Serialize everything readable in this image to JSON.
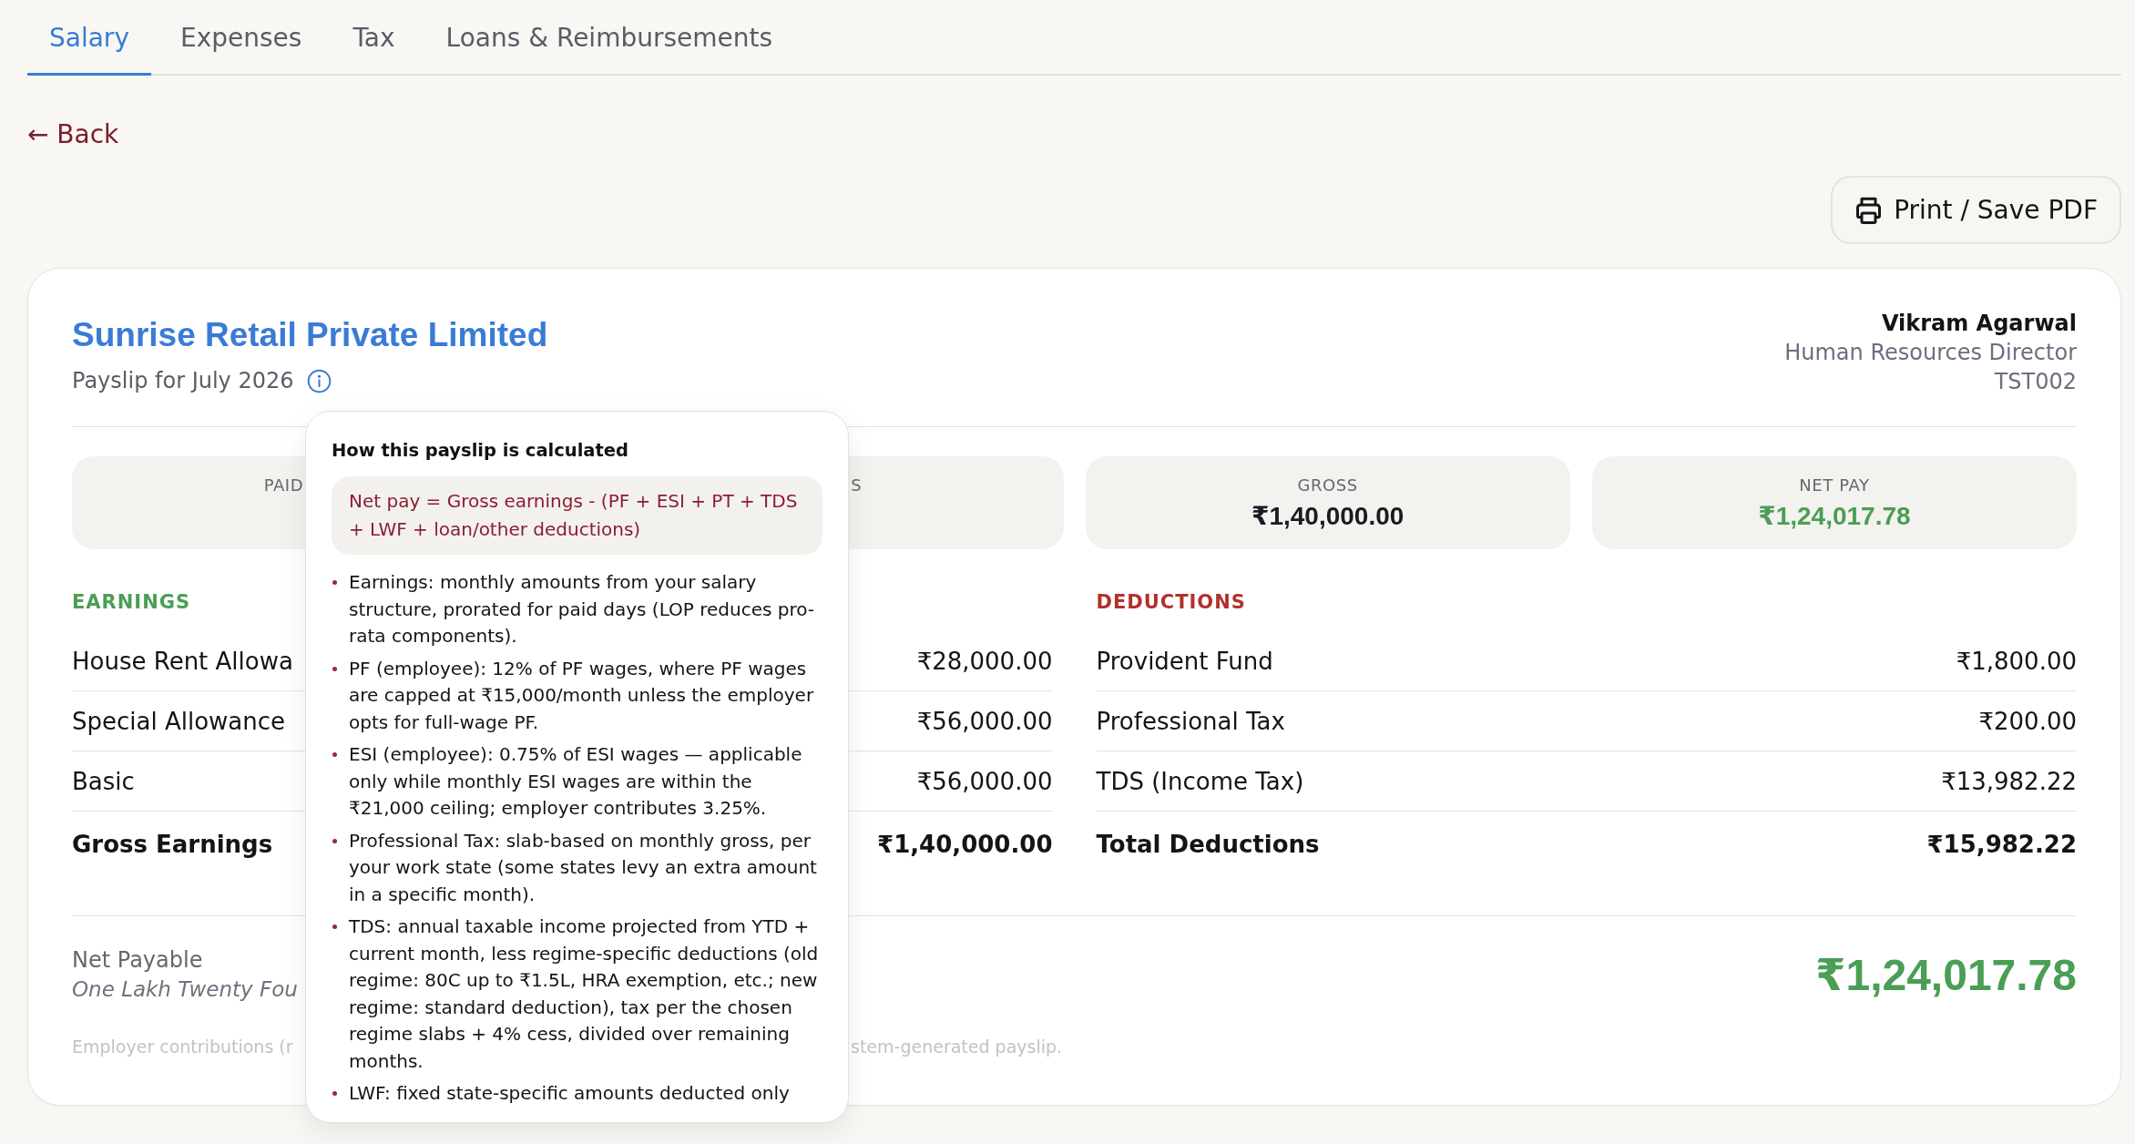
{
  "tabs": [
    {
      "label": "Salary",
      "selected": true
    },
    {
      "label": "Expenses",
      "selected": false
    },
    {
      "label": "Tax",
      "selected": false
    },
    {
      "label": "Loans & Reimbursements",
      "selected": false
    }
  ],
  "back_link": {
    "label": "← Back"
  },
  "print_button": {
    "label": "Print / Save PDF"
  },
  "payslip": {
    "company": "Sunrise Retail Private Limited",
    "period": "Payslip for July 2026",
    "employee": {
      "name": "Vikram Agarwal",
      "designation": "Human Resources Director",
      "id": "TST002"
    },
    "summary": [
      {
        "kind": "cut_right",
        "label": "PAID"
      },
      {
        "kind": "cut_left",
        "label": "S"
      },
      {
        "kind": "amount",
        "label": "GROSS",
        "value": "₹1,40,000.00"
      },
      {
        "kind": "net",
        "label": "NET PAY",
        "value": "₹1,24,017.78"
      }
    ],
    "sections": [
      {
        "kind": "earnings",
        "title": "EARNINGS",
        "rows": [
          {
            "label": "House Rent Allowa",
            "amount": "₹28,000.00"
          },
          {
            "label": "Special Allowance",
            "amount": "₹56,000.00"
          },
          {
            "label": "Basic",
            "amount": "₹56,000.00"
          }
        ],
        "total": {
          "label": "Gross Earnings",
          "amount": "₹1,40,000.00"
        }
      },
      {
        "kind": "deductions",
        "title": "DEDUCTIONS",
        "rows": [
          {
            "label": "Provident Fund",
            "amount": "₹1,800.00"
          },
          {
            "label": "Professional Tax",
            "amount": "₹200.00"
          },
          {
            "label": "TDS (Income Tax)",
            "amount": "₹13,982.22"
          }
        ],
        "total": {
          "label": "Total Deductions",
          "amount": "₹15,982.22"
        }
      }
    ],
    "net_payable": {
      "label": "Net Payable",
      "in_words": "One Lakh Twenty Fou",
      "amount": "₹1,24,017.78"
    },
    "footnote": [
      "Employer contributions (r",
      "stem-generated payslip."
    ]
  },
  "info_popover": {
    "title": "How this payslip is calculated",
    "formula": "Net pay = Gross earnings - (PF + ESI + PT + TDS + LWF + loan/other deductions)",
    "items": [
      "Earnings: monthly amounts from your salary structure, prorated for paid days (LOP reduces pro-rata components).",
      "PF (employee): 12% of PF wages, where PF wages are capped at ₹15,000/month unless the employer opts for full-wage PF.",
      "ESI (employee): 0.75% of ESI wages — applicable only while monthly ESI wages are within the ₹21,000 ceiling; employer contributes 3.25%.",
      "Professional Tax: slab-based on monthly gross, per your work state (some states levy an extra amount in a specific month).",
      "TDS: annual taxable income projected from YTD + current month, less regime-specific deductions (old regime: 80C up to ₹1.5L, HRA exemption, etc.; new regime: standard deduction), tax per the chosen regime slabs + 4% cess, divided over remaining months.",
      "LWF: fixed state-specific amounts deducted only"
    ]
  }
}
